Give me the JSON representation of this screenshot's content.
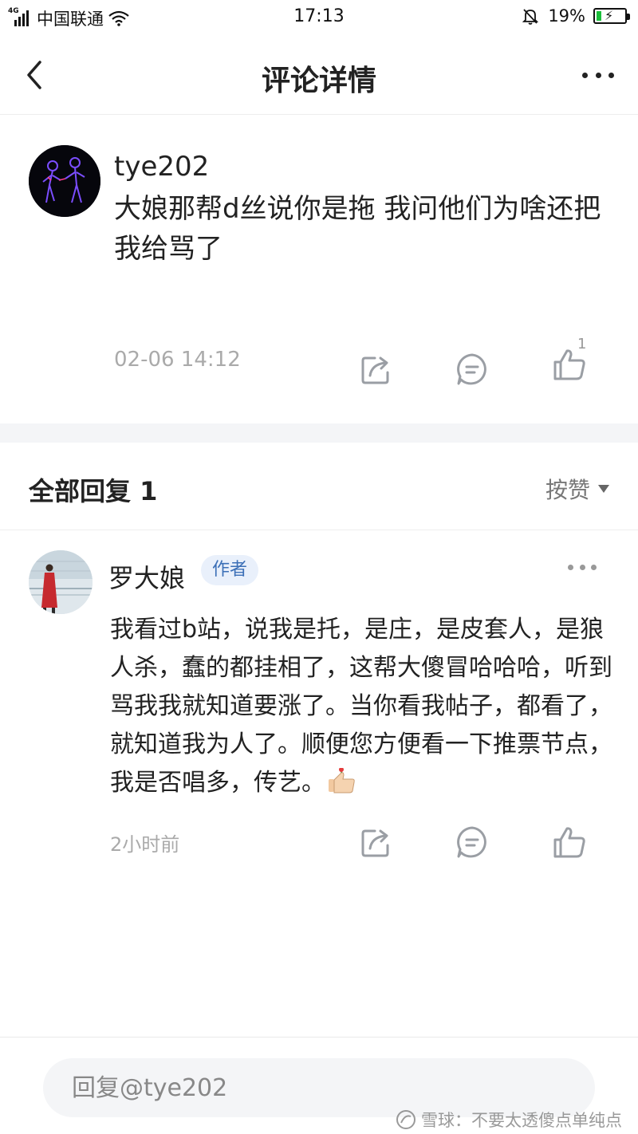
{
  "status_bar": {
    "network_type": "4G",
    "carrier": "中国联通",
    "time": "17:13",
    "battery": "19%",
    "battery_level": 0.19,
    "battery_color": "#1bbf3b"
  },
  "nav": {
    "title": "评论详情",
    "back_icon": "chevron-left-icon",
    "more_icon": "more-dots-icon"
  },
  "comment": {
    "username": "tye202",
    "text": "大娘那帮d丝说你是拖 我问他们为啥还把我给骂了",
    "time": "02-06 14:12",
    "like_count": "1",
    "icons": [
      "share-icon",
      "comment-icon",
      "like-icon"
    ]
  },
  "replies": {
    "title": "全部回复 1",
    "sort_label": "按赞",
    "items": [
      {
        "username": "罗大娘",
        "badge": "作者",
        "text": "我看过b站，说我是托，是庄，是皮套人，是狼人杀，蠢的都挂相了，这帮大傻冒哈哈哈，听到骂我我就知道要涨了。当你看我帖子，都看了，就知道我为人了。顺便您方便看一下推票节点，我是否唱多，传艺。",
        "time": "2小时前"
      }
    ]
  },
  "bottom": {
    "reply_placeholder": "回复@tye202"
  },
  "watermark": {
    "text": "雪球：不要太透傻点单纯点"
  },
  "colors": {
    "accent_badge_bg": "#e9f0fb",
    "accent_badge_text": "#3b6fb7",
    "muted_text": "#aaaaaa",
    "icon_gray": "#9a9ea4"
  }
}
